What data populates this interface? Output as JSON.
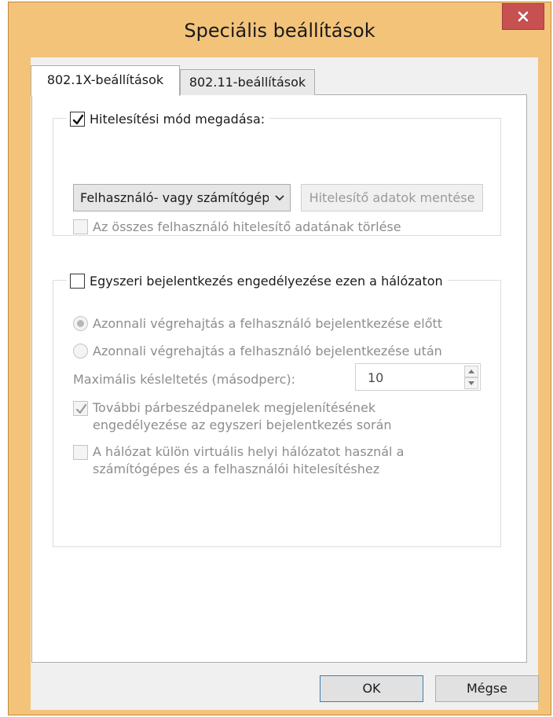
{
  "window": {
    "title": "Speciális beállítások",
    "close_label": "×"
  },
  "tabs": [
    {
      "label": "802.1X-beállítások",
      "active": true
    },
    {
      "label": "802.11-beállítások",
      "active": false
    }
  ],
  "auth_group": {
    "checkbox_label": "Hitelesítési mód megadása:",
    "checked": true,
    "mode_select_value": "Felhasználó- vagy számítógép",
    "save_credentials_label": "Hitelesítő adatok mentése",
    "delete_all_label": "Az összes felhasználó hitelesítő adatának törlése",
    "delete_all_checked": false
  },
  "sso_group": {
    "checkbox_label": "Egyszeri bejelentkezés engedélyezése ezen a hálózaton",
    "checked": false,
    "radio_before_label": "Azonnali végrehajtás a felhasználó bejelentkezése előtt",
    "radio_before_selected": true,
    "radio_after_label": "Azonnali végrehajtás a felhasználó bejelentkezése után",
    "radio_after_selected": false,
    "max_delay_label": "Maximális késleltetés (másodperc):",
    "max_delay_value": "10",
    "additional_dialogs_line1": "További párbeszédpanelek megjelenítésének",
    "additional_dialogs_line2": "engedélyezése az egyszeri bejelentkezés során",
    "additional_dialogs_checked": true,
    "vlan_line1": "A hálózat külön virtuális helyi hálózatot használ a",
    "vlan_line2": "számítógépes és a felhasználói hitelesítéshez",
    "vlan_checked": false
  },
  "buttons": {
    "ok_label": "OK",
    "cancel_label": "Mégse"
  },
  "colors": {
    "frame": "#f3c37a",
    "close_button": "#c75050",
    "disabled_text": "#8d8d8d"
  }
}
